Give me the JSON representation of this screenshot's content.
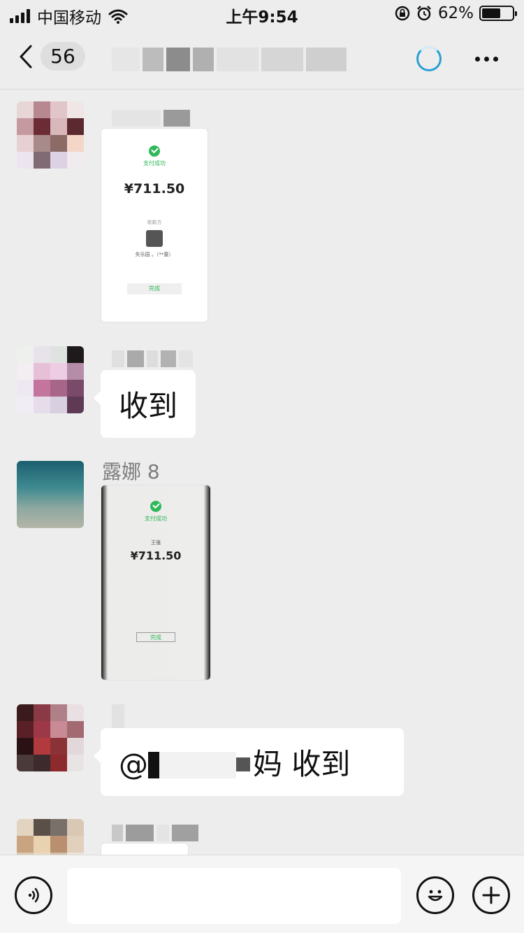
{
  "status_bar": {
    "carrier": "中国移动",
    "time": "上午9:54",
    "battery_percent": "62%",
    "battery_level": 0.62
  },
  "nav": {
    "unread_count": "56"
  },
  "messages": [
    {
      "type": "image",
      "image": {
        "status": "支付成功",
        "amount": "¥711.50",
        "payee_label": "收款方",
        "payee_name": "失乐园 。（**童）",
        "button": "完成"
      }
    },
    {
      "type": "text",
      "text": "收到"
    },
    {
      "type": "image",
      "sender": "露娜 8",
      "image": {
        "status": "支付成功",
        "payee_name": "王强",
        "amount": "¥711.50",
        "button": "完成"
      }
    },
    {
      "type": "text",
      "text_prefix": "@",
      "text_suffix": "妈 收到"
    }
  ],
  "input": {
    "placeholder": ""
  },
  "colors": {
    "background": "#ededed",
    "bubble": "#ffffff",
    "wechat_green": "#2fb85a",
    "loading_blue": "#2a9fd6"
  }
}
